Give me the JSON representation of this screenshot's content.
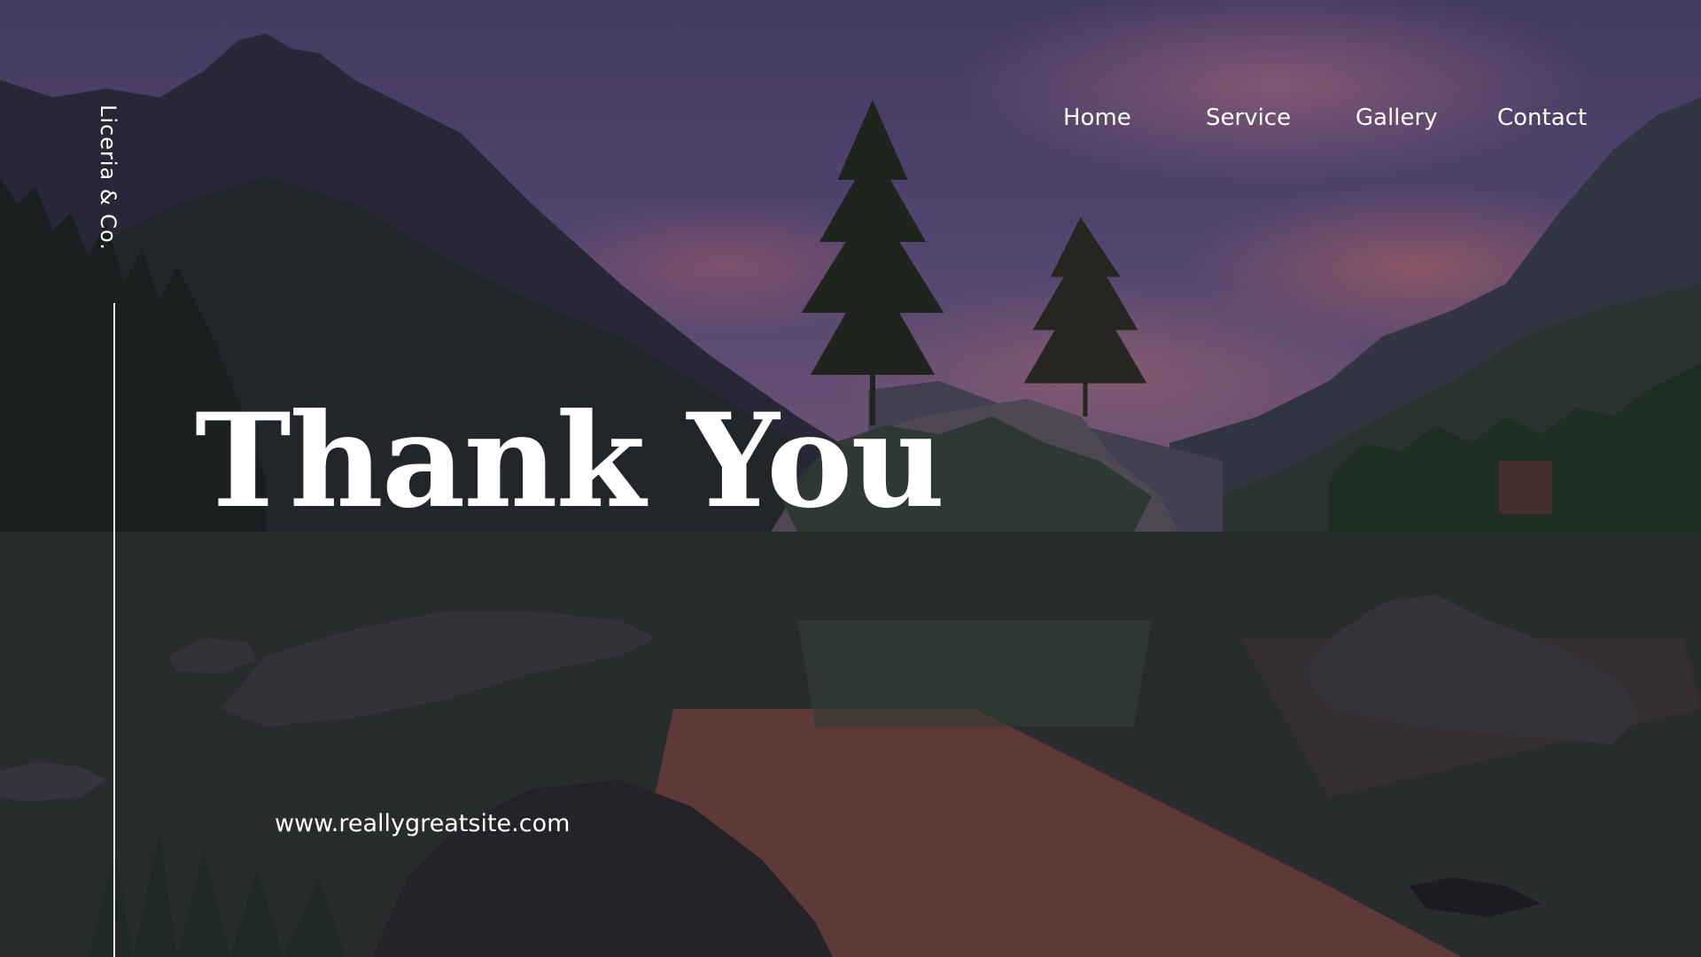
{
  "brand": {
    "name": "Liceria & Co."
  },
  "nav": {
    "items": [
      {
        "label": "Home"
      },
      {
        "label": "Service"
      },
      {
        "label": "Gallery"
      },
      {
        "label": "Contact"
      }
    ]
  },
  "hero": {
    "title": "Thank You",
    "website": "www.reallygreatsite.com"
  },
  "colors": {
    "text": "#ffffff",
    "sky_top": "#4d4470",
    "sunset_glow": "#d68096",
    "water": "#2c2f35"
  },
  "icons": {
    "background": "mountain-lake-landscape-image"
  }
}
